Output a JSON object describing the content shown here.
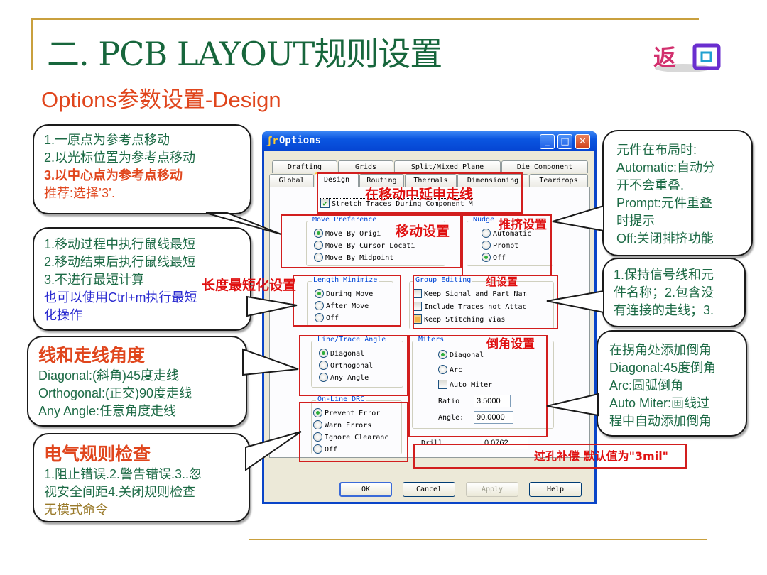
{
  "slide": {
    "title": "二. PCB LAYOUT规则设置",
    "subtitle": "Options参数设置-Design",
    "back_button_label": "返回"
  },
  "callouts": {
    "move_reference": {
      "line1": "1.一原点为参考点移动",
      "line2": "2.以光标位置为参考点移动",
      "line3": "3.以中心点为参考点移动",
      "line4": "推荐:选择’3’."
    },
    "length_minimize": {
      "line1": "1.移动过程中执行鼠线最短",
      "line2": "2.移动结束后执行鼠线最短",
      "line3": "3.不进行最短计算",
      "line4": "也可以使用Ctrl+m执行最短",
      "line5": "化操作"
    },
    "trace_angle": {
      "heading": "线和走线角度",
      "line1": "Diagonal:(斜角)45度走线",
      "line2": "Orthogonal:(正交)90度走线",
      "line3": "Any Angle:任意角度走线"
    },
    "drc": {
      "heading": "电气规则检查",
      "line1": "1.阻止错误.2.警告错误.3..忽",
      "line2": "视安全间距4.关闭规则检查",
      "link": "无模式命令"
    },
    "nudge": {
      "line1": "元件在布局时:",
      "line2": "Automatic:自动分",
      "line3": "开不会重叠.",
      "line4": "Prompt:元件重叠",
      "line5": "时提示",
      "line6": "Off:关闭排挤功能"
    },
    "group_editing": {
      "line1": "1.保持信号线和元",
      "line2": "件名称；2.包含没",
      "line3": "有连接的走线；3."
    },
    "miters": {
      "line1": "在拐角处添加倒角",
      "line2": "Diagonal:45度倒角",
      "line3": "Arc:圆弧倒角",
      "line4": "Auto Miter:画线过",
      "line5": "程中自动添加倒角"
    }
  },
  "annotations": {
    "stretch": "在移动中延申走线",
    "move": "移动设置",
    "nudge": "推挤设置",
    "length": "长度最短化设置",
    "group": "组设置",
    "miters": "倒角设置",
    "drill": "过孔补偿 默认值为\"3mil\""
  },
  "dialog": {
    "title": "Options",
    "app_icon": "ʃr",
    "minimize_icon": "_",
    "maximize_icon": "□",
    "close_icon": "✕",
    "tabs_row1": [
      "Drafting",
      "Grids",
      "Split/Mixed Plane",
      "Die Component"
    ],
    "tabs_row2": [
      "Global",
      "Design",
      "Routing",
      "Thermals",
      "Dimensioning",
      "Teardrops"
    ],
    "active_tab": "Design",
    "stretch_traces": {
      "label": "Stretch Traces During Component M",
      "checked": true
    },
    "move_preference": {
      "label": "Move Preference",
      "options": [
        "Move By Origi",
        "Move By Cursor Locati",
        "Move By Midpoint"
      ],
      "selected": "Move By Origi"
    },
    "nudge": {
      "label": "Nudge",
      "options": [
        "Automatic",
        "Prompt",
        "Off"
      ],
      "selected": "Off"
    },
    "length_minimize": {
      "label": "Length Minimize",
      "options": [
        "During Move",
        "After Move",
        "Off"
      ],
      "selected": "During Move"
    },
    "group_editing": {
      "label": "Group Editing",
      "options": [
        {
          "label": "Keep Signal and Part Nam",
          "state": "unchecked"
        },
        {
          "label": "Include Traces not Attac",
          "state": "unchecked"
        },
        {
          "label": "Keep Stitching Vias",
          "state": "indeterminate"
        }
      ]
    },
    "line_trace_angle": {
      "label": "Line/Trace Angle",
      "options": [
        "Diagonal",
        "Orthogonal",
        "Any Angle"
      ],
      "selected": "Diagonal"
    },
    "miters": {
      "label": "Miters",
      "options": [
        "Diagonal",
        "Arc"
      ],
      "selected": "Diagonal",
      "auto_miter": {
        "label": "Auto Miter",
        "checked": false
      },
      "ratio_label": "Ratio",
      "ratio_value": "3.5000",
      "angle_label": "Angle:",
      "angle_value": "90.0000"
    },
    "online_drc": {
      "label": "On-Line DRC",
      "options": [
        "Prevent Error",
        "Warn Errors",
        "Ignore Clearanc",
        "Off"
      ],
      "selected": "Prevent Error"
    },
    "drill": {
      "label": "Drill",
      "value": "0.0762"
    },
    "buttons": {
      "ok": "OK",
      "cancel": "Cancel",
      "apply": "Apply",
      "help": "Help"
    }
  }
}
